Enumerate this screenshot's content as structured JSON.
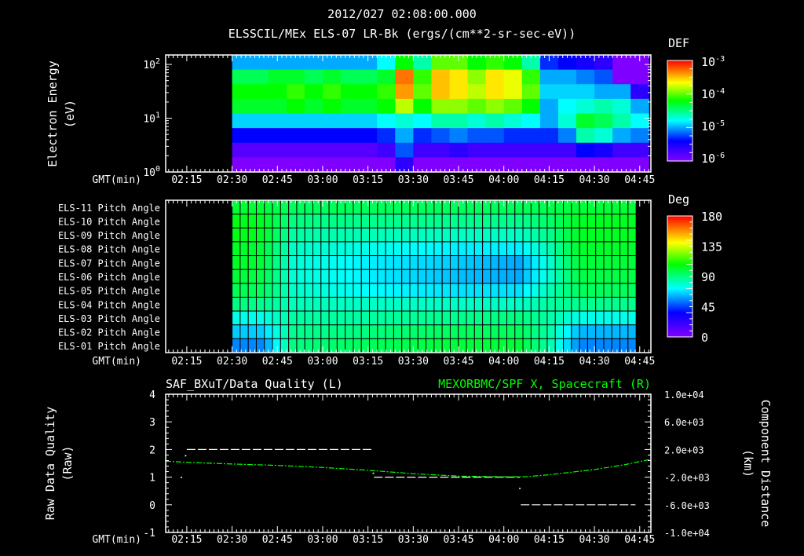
{
  "header": {
    "timestamp": "2012/027 02:08:00.000",
    "title": "ELSSCIL/MEx ELS-07 LR-Bk  (ergs/(cm**2-sr-sec-eV))"
  },
  "colormap": {
    "stops": [
      0,
      0.2,
      0.4,
      0.6,
      0.78,
      1
    ],
    "colors": [
      "#8000ff",
      "#0000ff",
      "#00ffff",
      "#00ff00",
      "#ffff00",
      "#ff0000"
    ]
  },
  "time_axis": {
    "label": "GMT(min)",
    "ticks": [
      "02:15",
      "02:30",
      "02:45",
      "03:00",
      "03:15",
      "03:30",
      "03:45",
      "04:00",
      "04:15",
      "04:30",
      "04:45"
    ],
    "tick_minutes": [
      135,
      150,
      165,
      180,
      195,
      210,
      225,
      240,
      255,
      270,
      285
    ],
    "xlim_minutes": [
      128,
      288.7
    ]
  },
  "chart_data": [
    {
      "type": "heatmap",
      "name": "energy-spectrogram",
      "ylabel": "Electron Energy",
      "yunit": "(eV)",
      "yscale": "log",
      "ylim": [
        1,
        150
      ],
      "yticks": [
        {
          "base": "10",
          "exp": "0"
        },
        {
          "base": "10",
          "exp": "1"
        },
        {
          "base": "10",
          "exp": "2"
        }
      ],
      "colorbar": {
        "title": "DEF",
        "range_log10": [
          -6,
          -3
        ],
        "labels": [
          {
            "base": "10",
            "exp": "-3"
          },
          {
            "base": "10",
            "exp": "-4"
          },
          {
            "base": "10",
            "exp": "-5"
          },
          {
            "base": "10",
            "exp": "-6"
          }
        ]
      },
      "time_start_min": 150,
      "time_bin_min": 6,
      "rows_note_top_to_bottom": "high energy to low energy",
      "log10_def": [
        [
          -5.0,
          -4.4,
          -4.2,
          -4.3,
          -4.9,
          -5.4,
          -5.8,
          -6.0
        ],
        [
          -5.0,
          -4.4,
          -4.2,
          -4.3,
          -4.9,
          -5.4,
          -5.8,
          -6.0
        ],
        [
          -5.0,
          -4.3,
          -4.2,
          -4.3,
          -4.9,
          -5.4,
          -5.8,
          -6.0
        ],
        [
          -5.0,
          -4.3,
          -4.1,
          -4.2,
          -4.9,
          -5.4,
          -5.8,
          -6.0
        ],
        [
          -5.0,
          -4.4,
          -4.2,
          -4.3,
          -4.9,
          -5.4,
          -5.8,
          -6.0
        ],
        [
          -5.0,
          -4.3,
          -4.1,
          -4.2,
          -4.9,
          -5.4,
          -5.8,
          -6.0
        ],
        [
          -5.0,
          -4.4,
          -4.2,
          -4.3,
          -4.9,
          -5.4,
          -5.8,
          -6.0
        ],
        [
          -5.0,
          -4.4,
          -4.2,
          -4.3,
          -4.9,
          -5.4,
          -5.8,
          -6.0
        ],
        [
          -4.8,
          -4.3,
          -4.1,
          -4.2,
          -4.8,
          -5.3,
          -5.7,
          -6.0
        ],
        [
          -4.2,
          -3.3,
          -3.4,
          -3.8,
          -4.7,
          -5.0,
          -5.2,
          -5.6
        ],
        [
          -4.6,
          -4.1,
          -4.0,
          -4.2,
          -4.8,
          -5.3,
          -5.7,
          -6.0
        ],
        [
          -4.0,
          -3.5,
          -3.5,
          -3.9,
          -4.6,
          -5.2,
          -5.7,
          -6.0
        ],
        [
          -4.0,
          -3.6,
          -3.6,
          -3.9,
          -4.6,
          -5.1,
          -5.6,
          -6.0
        ],
        [
          -4.2,
          -3.9,
          -3.8,
          -4.0,
          -4.7,
          -5.2,
          -5.7,
          -6.0
        ],
        [
          -4.1,
          -3.6,
          -3.6,
          -3.9,
          -4.6,
          -5.2,
          -5.7,
          -6.0
        ],
        [
          -4.2,
          -3.7,
          -3.7,
          -4.0,
          -4.7,
          -5.3,
          -5.7,
          -6.0
        ],
        [
          -4.6,
          -4.1,
          -4.0,
          -4.2,
          -4.8,
          -5.3,
          -5.7,
          -6.0
        ],
        [
          -5.3,
          -5.0,
          -4.9,
          -5.0,
          -5.0,
          -5.3,
          -5.7,
          -6.0
        ],
        [
          -5.4,
          -5.0,
          -4.9,
          -4.8,
          -4.7,
          -5.1,
          -5.7,
          -6.0
        ],
        [
          -5.5,
          -5.1,
          -4.9,
          -4.7,
          -4.3,
          -4.6,
          -5.4,
          -6.0
        ],
        [
          -5.6,
          -5.2,
          -5.0,
          -4.6,
          -4.4,
          -4.7,
          -5.5,
          -6.0
        ],
        [
          -6.2,
          -6.0,
          -5.0,
          -4.7,
          -4.6,
          -5.0,
          -5.7,
          -6.1
        ],
        [
          -6.3,
          -6.0,
          -5.6,
          -5.0,
          -4.8,
          -5.1,
          -5.7,
          -6.1
        ]
      ]
    },
    {
      "type": "heatmap",
      "name": "pitch-angle",
      "colorbar": {
        "title": "Deg",
        "range": [
          0,
          180
        ],
        "labels": [
          "180",
          "135",
          "90",
          "45",
          "0"
        ]
      },
      "row_labels": [
        "ELS-11 Pitch Angle",
        "ELS-10 Pitch Angle",
        "ELS-09 Pitch Angle",
        "ELS-08 Pitch Angle",
        "ELS-07 Pitch Angle",
        "ELS-06 Pitch Angle",
        "ELS-05 Pitch Angle",
        "ELS-04 Pitch Angle",
        "ELS-03 Pitch Angle",
        "ELS-02 Pitch Angle",
        "ELS-01 Pitch Angle"
      ],
      "time_range_min": [
        150,
        283.8
      ],
      "n_columns": 50,
      "key_times_min": [
        150,
        160,
        170,
        195,
        225,
        245,
        255,
        265,
        283.8
      ],
      "degrees": [
        [
          100,
          100,
          95,
          95,
          95,
          95,
          97,
          100,
          100
        ],
        [
          105,
          103,
          90,
          88,
          88,
          88,
          93,
          103,
          103
        ],
        [
          105,
          103,
          85,
          82,
          80,
          80,
          88,
          103,
          103
        ],
        [
          103,
          100,
          80,
          75,
          70,
          70,
          82,
          102,
          102
        ],
        [
          103,
          100,
          78,
          70,
          65,
          60,
          78,
          100,
          100
        ],
        [
          100,
          98,
          78,
          70,
          63,
          60,
          78,
          98,
          98
        ],
        [
          97,
          95,
          80,
          72,
          68,
          68,
          82,
          95,
          95
        ],
        [
          90,
          88,
          82,
          80,
          80,
          80,
          85,
          88,
          88
        ],
        [
          75,
          75,
          85,
          85,
          88,
          90,
          85,
          75,
          75
        ],
        [
          65,
          65,
          88,
          90,
          95,
          95,
          85,
          62,
          62
        ],
        [
          55,
          55,
          90,
          95,
          100,
          100,
          85,
          55,
          55
        ]
      ]
    },
    {
      "type": "line",
      "name": "data-quality-and-position",
      "left_title": "SAF_BXuT/Data Quality (L)",
      "right_title": "MEXORBMC/SPF X, Spacecraft (R)",
      "right_color": "#00ff00",
      "ylabel_left": "Raw Data Quality",
      "yunit_left": "(Raw)",
      "ylabel_right": "Component Distance",
      "yunit_right": "(km)",
      "ylim_left": [
        -1,
        4
      ],
      "yticks_left": [
        "4",
        "3",
        "2",
        "1",
        "0",
        "-1"
      ],
      "ylim_right": [
        -10000,
        10000
      ],
      "yticks_right": [
        "1.0e+04",
        "6.0e+03",
        "2.0e+03",
        "-2.0e+03",
        "-6.0e+03",
        "-1.0e+04"
      ],
      "quality_segments": [
        {
          "from": 135,
          "to": 196.6,
          "value": 2
        },
        {
          "from": 197,
          "to": 245.3,
          "value": 1
        },
        {
          "from": 245.6,
          "to": 283.6,
          "value": 0
        }
      ],
      "quality_points": [
        [
          133.2,
          1.0
        ],
        [
          134.6,
          1.78
        ],
        [
          245.3,
          0.6
        ],
        [
          196.8,
          1.15
        ]
      ],
      "position_km": [
        [
          128,
          300
        ],
        [
          135,
          150
        ],
        [
          150,
          -100
        ],
        [
          165,
          -300
        ],
        [
          180,
          -600
        ],
        [
          195,
          -1000
        ],
        [
          210,
          -1500
        ],
        [
          225,
          -1850
        ],
        [
          240,
          -1950
        ],
        [
          247,
          -1950
        ],
        [
          255,
          -1650
        ],
        [
          270,
          -900
        ],
        [
          280,
          -200
        ],
        [
          288.7,
          600
        ]
      ]
    }
  ]
}
